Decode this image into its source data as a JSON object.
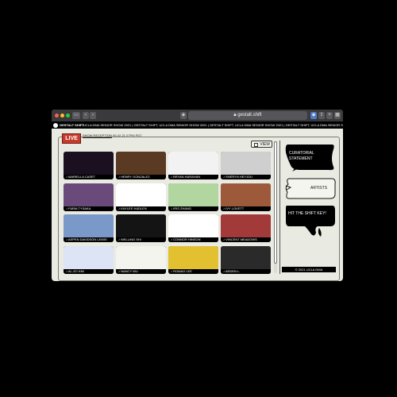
{
  "browser": {
    "url": "gestalt.shift",
    "controls": [
      "sidebar-icon",
      "back-icon",
      "forward-icon",
      "shield-icon",
      "reader-icon",
      "refresh-icon",
      "extension-icon",
      "share-icon",
      "new-tab-icon",
      "tabs-icon"
    ]
  },
  "site": {
    "logo": "GESTALT SHIFT",
    "ticker": "UCLA DMA SENIOR SHOW 2021  |  GESTALT SHIFT, UCLA DMA SENIOR SHOW 2021  |  GESTALT SHIFT, UCLA DMA SENIOR SHOW 2021  |  GESTALT SHIFT, UCLA DMA SENIOR SHOW 2021  |  GESTALT SHIFT, UCLA DMA SENIOR SH"
  },
  "header": {
    "live_label": "LIVE",
    "show_link": "SHOW RECEPTION",
    "show_time": "06-02-21 07PM PDT",
    "view_label": "VIEW"
  },
  "artists": [
    {
      "name": "MARIELLA CASET",
      "bg": "#1a1020"
    },
    {
      "name": "HENRY GONZALEZ",
      "bg": "#5a3a22"
    },
    {
      "name": "BRYAN HARAHAN",
      "bg": "#f2f2f2"
    },
    {
      "name": "SHERYN HEYJOU",
      "bg": "#cfcfcf"
    },
    {
      "name": "FARIA TYSAKA",
      "bg": "#6a4a7a"
    },
    {
      "name": "KAYLEE HADLEN",
      "bg": "#ffffff"
    },
    {
      "name": "IRIS ZHANG",
      "bg": "#b2d6a0"
    },
    {
      "name": "IVY LOVETT",
      "bg": "#9c5a3a"
    },
    {
      "name": "ASPEN DAVIDSON LEWIS",
      "bg": "#7a98c8"
    },
    {
      "name": "WELLING SHI",
      "bg": "#141414"
    },
    {
      "name": "CONNOR HINSON",
      "bg": "#ffffff"
    },
    {
      "name": "VINCENT MEADOWS",
      "bg": "#a23a3a"
    },
    {
      "name": "AL-ZO KIM",
      "bg": "#dce4f6"
    },
    {
      "name": "NANCY WU",
      "bg": "#f4f4ee"
    },
    {
      "name": "ROMAO LEE",
      "bg": "#e2c030"
    },
    {
      "name": "ARDEN L.",
      "bg": "#2a2a2a"
    }
  ],
  "sidebar": {
    "curatorial": "CURATORIAL STATEMENT",
    "artists": "ARTISTS",
    "shift": "HIT THE SHIFT KEY!",
    "footer": "© 2021 UCLA DMA"
  }
}
